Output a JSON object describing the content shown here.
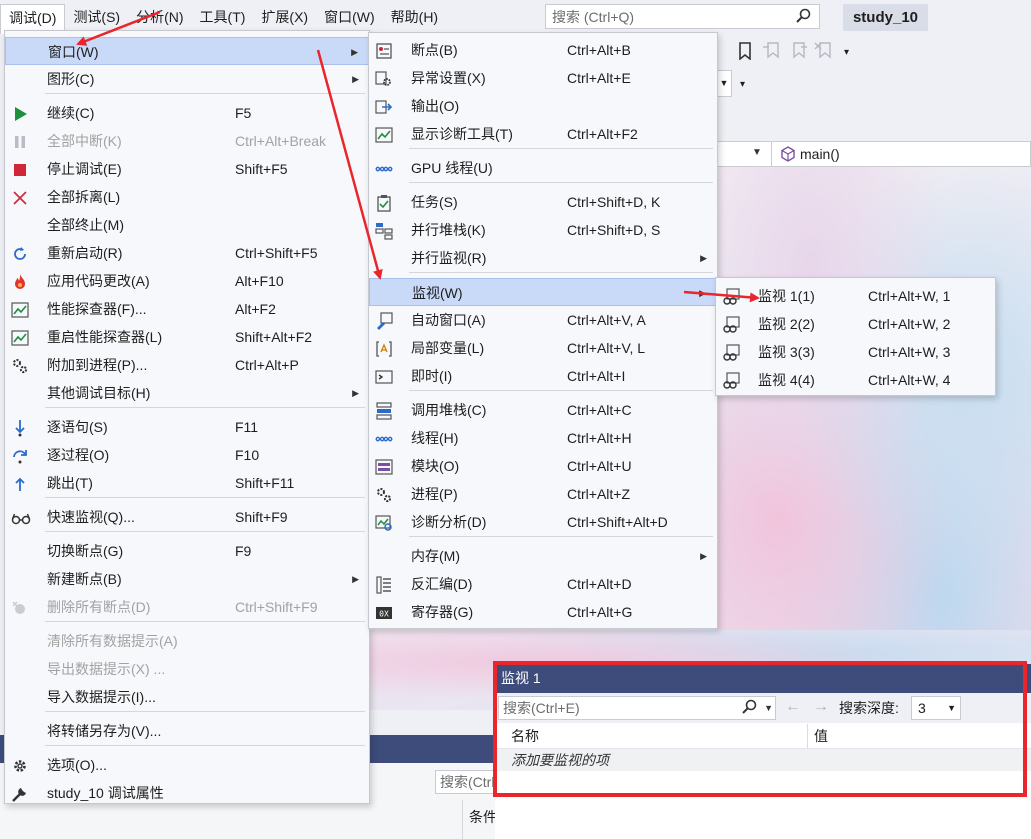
{
  "menubar": {
    "items": [
      "调试(D)",
      "测试(S)",
      "分析(N)",
      "工具(T)",
      "扩展(X)",
      "窗口(W)",
      "帮助(H)"
    ],
    "search_placeholder": "搜索 (Ctrl+Q)",
    "project_name": "study_10"
  },
  "navbar": {
    "function": "main()"
  },
  "debug_menu": {
    "items": [
      {
        "label": "窗口(W)",
        "shortcut": "",
        "icon": "none",
        "submenu": true,
        "highlighted": true
      },
      {
        "label": "图形(C)",
        "shortcut": "",
        "icon": "none",
        "submenu": true
      },
      {
        "label": "继续(C)",
        "shortcut": "F5",
        "icon": "play-icon"
      },
      {
        "label": "全部中断(K)",
        "shortcut": "Ctrl+Alt+Break",
        "icon": "pause-icon",
        "disabled": true
      },
      {
        "label": "停止调试(E)",
        "shortcut": "Shift+F5",
        "icon": "stop-icon"
      },
      {
        "label": "全部拆离(L)",
        "shortcut": "",
        "icon": "close-icon"
      },
      {
        "label": "全部终止(M)",
        "shortcut": "",
        "icon": "none"
      },
      {
        "label": "重新启动(R)",
        "shortcut": "Ctrl+Shift+F5",
        "icon": "restart-icon"
      },
      {
        "label": "应用代码更改(A)",
        "shortcut": "Alt+F10",
        "icon": "flame-icon"
      },
      {
        "label": "性能探查器(F)...",
        "shortcut": "Alt+F2",
        "icon": "chart-icon"
      },
      {
        "label": "重启性能探查器(L)",
        "shortcut": "Shift+Alt+F2",
        "icon": "chart-icon"
      },
      {
        "label": "附加到进程(P)...",
        "shortcut": "Ctrl+Alt+P",
        "icon": "gears-icon"
      },
      {
        "label": "其他调试目标(H)",
        "shortcut": "",
        "icon": "none",
        "submenu": true
      },
      {
        "label": "逐语句(S)",
        "shortcut": "F11",
        "icon": "step-into-icon"
      },
      {
        "label": "逐过程(O)",
        "shortcut": "F10",
        "icon": "step-over-icon"
      },
      {
        "label": "跳出(T)",
        "shortcut": "Shift+F11",
        "icon": "step-out-icon"
      },
      {
        "label": "快速监视(Q)...",
        "shortcut": "Shift+F9",
        "icon": "glasses-icon"
      },
      {
        "label": "切换断点(G)",
        "shortcut": "F9",
        "icon": "none"
      },
      {
        "label": "新建断点(B)",
        "shortcut": "",
        "icon": "none",
        "submenu": true
      },
      {
        "label": "删除所有断点(D)",
        "shortcut": "Ctrl+Shift+F9",
        "icon": "delete-breakpoints-icon",
        "disabled": true
      },
      {
        "label": "清除所有数据提示(A)",
        "shortcut": "",
        "icon": "none",
        "disabled": true
      },
      {
        "label": "导出数据提示(X) ...",
        "shortcut": "",
        "icon": "none",
        "disabled": true
      },
      {
        "label": "导入数据提示(I)...",
        "shortcut": "",
        "icon": "none"
      },
      {
        "label": "将转储另存为(V)...",
        "shortcut": "",
        "icon": "none"
      },
      {
        "label": "选项(O)...",
        "shortcut": "",
        "icon": "gear-icon"
      },
      {
        "label": "study_10 调试属性",
        "shortcut": "",
        "icon": "wrench-icon"
      }
    ]
  },
  "window_menu": {
    "items": [
      {
        "label": "断点(B)",
        "shortcut": "Ctrl+Alt+B",
        "icon": "breakpoints-icon"
      },
      {
        "label": "异常设置(X)",
        "shortcut": "Ctrl+Alt+E",
        "icon": "exception-icon"
      },
      {
        "label": "输出(O)",
        "shortcut": "",
        "icon": "output-icon"
      },
      {
        "label": "显示诊断工具(T)",
        "shortcut": "Ctrl+Alt+F2",
        "icon": "diagnostic-icon"
      },
      {
        "label": "GPU 线程(U)",
        "shortcut": "",
        "icon": "thread-icon"
      },
      {
        "label": "任务(S)",
        "shortcut": "Ctrl+Shift+D, K",
        "icon": "task-icon"
      },
      {
        "label": "并行堆栈(K)",
        "shortcut": "Ctrl+Shift+D, S",
        "icon": "parallel-stack-icon"
      },
      {
        "label": "并行监视(R)",
        "shortcut": "",
        "icon": "none",
        "submenu": true
      },
      {
        "label": "监视(W)",
        "shortcut": "",
        "icon": "none",
        "submenu": true,
        "highlighted": true
      },
      {
        "label": "自动窗口(A)",
        "shortcut": "Ctrl+Alt+V, A",
        "icon": "autos-icon"
      },
      {
        "label": "局部变量(L)",
        "shortcut": "Ctrl+Alt+V, L",
        "icon": "locals-icon"
      },
      {
        "label": "即时(I)",
        "shortcut": "Ctrl+Alt+I",
        "icon": "immediate-icon"
      },
      {
        "label": "调用堆栈(C)",
        "shortcut": "Ctrl+Alt+C",
        "icon": "call-stack-icon"
      },
      {
        "label": "线程(H)",
        "shortcut": "Ctrl+Alt+H",
        "icon": "thread-icon"
      },
      {
        "label": "模块(O)",
        "shortcut": "Ctrl+Alt+U",
        "icon": "modules-icon"
      },
      {
        "label": "进程(P)",
        "shortcut": "Ctrl+Alt+Z",
        "icon": "gears-icon"
      },
      {
        "label": "诊断分析(D)",
        "shortcut": "Ctrl+Shift+Alt+D",
        "icon": "diagnostic-analysis-icon"
      },
      {
        "label": "内存(M)",
        "shortcut": "",
        "icon": "none",
        "submenu": true
      },
      {
        "label": "反汇编(D)",
        "shortcut": "Ctrl+Alt+D",
        "icon": "disassembly-icon"
      },
      {
        "label": "寄存器(G)",
        "shortcut": "Ctrl+Alt+G",
        "icon": "registers-icon"
      }
    ]
  },
  "watch_menu": {
    "items": [
      {
        "label": "监视 1(1)",
        "shortcut": "Ctrl+Alt+W, 1",
        "icon": "watch-icon"
      },
      {
        "label": "监视 2(2)",
        "shortcut": "Ctrl+Alt+W, 2",
        "icon": "watch-icon"
      },
      {
        "label": "监视 3(3)",
        "shortcut": "Ctrl+Alt+W, 3",
        "icon": "watch-icon"
      },
      {
        "label": "监视 4(4)",
        "shortcut": "Ctrl+Alt+W, 4",
        "icon": "watch-icon"
      }
    ]
  },
  "watch_panel": {
    "title": "监视 1",
    "search_placeholder": "搜索(Ctrl+E)",
    "depth_label": "搜索深度:",
    "depth_value": "3",
    "col_name": "名称",
    "col_value": "值",
    "add_item": "添加要监视的项"
  },
  "bottom": {
    "search_placeholder": "搜索(Ctrl",
    "col_condition": "条件"
  },
  "colors": {
    "accent": "#3d4c7a",
    "highlight": "#c9d9f8",
    "annotation": "#e8262b"
  }
}
